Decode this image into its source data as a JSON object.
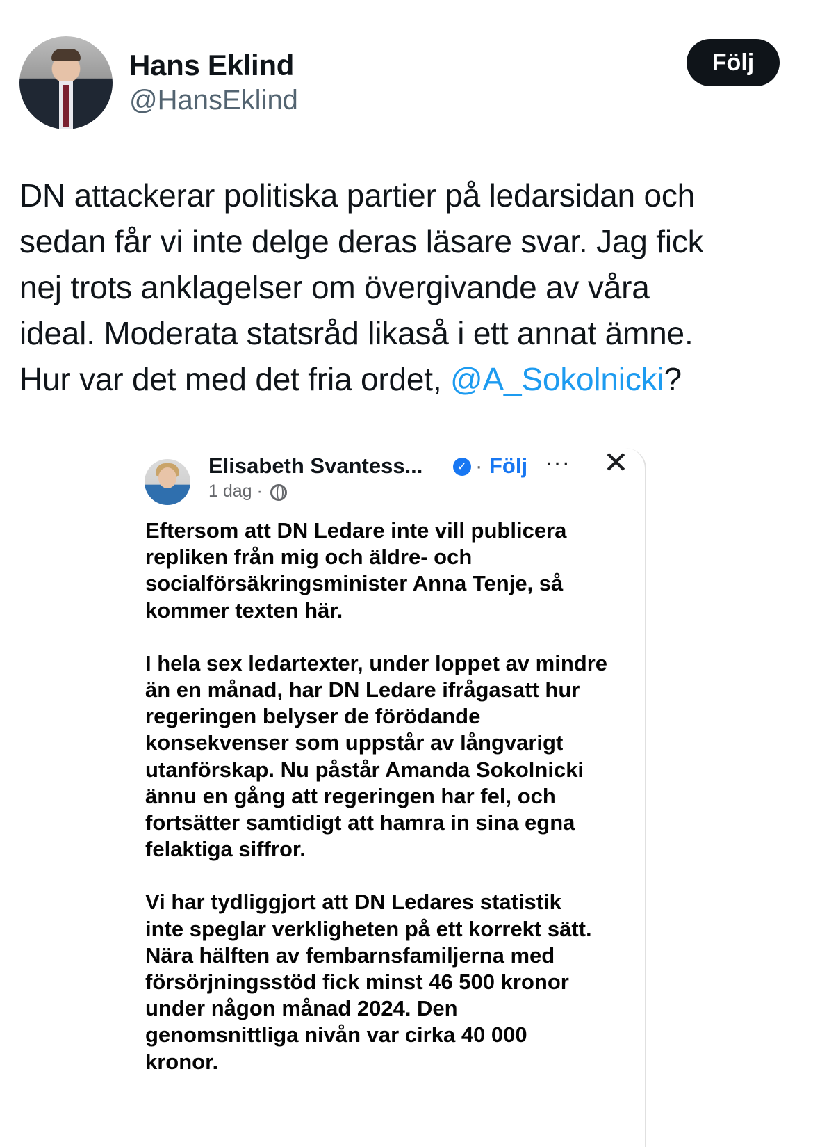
{
  "tweet": {
    "author_name": "Hans Eklind",
    "author_handle": "@HansEklind",
    "follow_label": "Följ",
    "text_lines": [
      "DN attackerar politiska partier på ledarsidan och",
      "sedan får vi inte delge deras läsare svar. Jag fick",
      "nej trots anklagelser om övergivande av våra",
      "ideal. Moderata statsråd likaså i ett annat ämne."
    ],
    "last_line_prefix": "Hur var det med det fria ordet, ",
    "mention": "@A_Sokolnicki",
    "last_line_suffix": "?"
  },
  "embedded_post": {
    "author_name": "Elisabeth Svantess...",
    "verified_icon": "check-icon",
    "separator": "·",
    "follow_label": "Följ",
    "more_label": "···",
    "close_label": "✕",
    "time": "1 dag ·",
    "paragraphs": [
      [
        "Eftersom att DN Ledare inte vill publicera",
        "repliken från mig och äldre- och",
        "socialförsäkringsminister Anna Tenje, så",
        "kommer texten här."
      ],
      [
        "I hela sex ledartexter, under loppet av mindre",
        "än en månad, har DN Ledare ifrågasatt hur",
        "regeringen belyser de förödande",
        "konsekvenser som uppstår av långvarigt",
        "utanförskap. Nu påstår Amanda Sokolnicki",
        "ännu en gång att regeringen har fel, och",
        "fortsätter samtidigt att hamra in sina egna",
        "felaktiga siffror."
      ],
      [
        "Vi har tydliggjort att DN Ledares statistik",
        "inte speglar verkligheten på ett korrekt sätt.",
        "Nära hälften av fembarnsfamiljerna med",
        "försörjningsstöd fick minst 46 500 kronor",
        "under någon månad 2024. Den",
        "genomsnittliga nivån var cirka 40 000",
        "kronor."
      ]
    ]
  },
  "colors": {
    "link_blue": "#1d9bf0",
    "facebook_blue": "#1877f2",
    "text_dark": "#0f1419",
    "muted_gray": "#536471"
  }
}
